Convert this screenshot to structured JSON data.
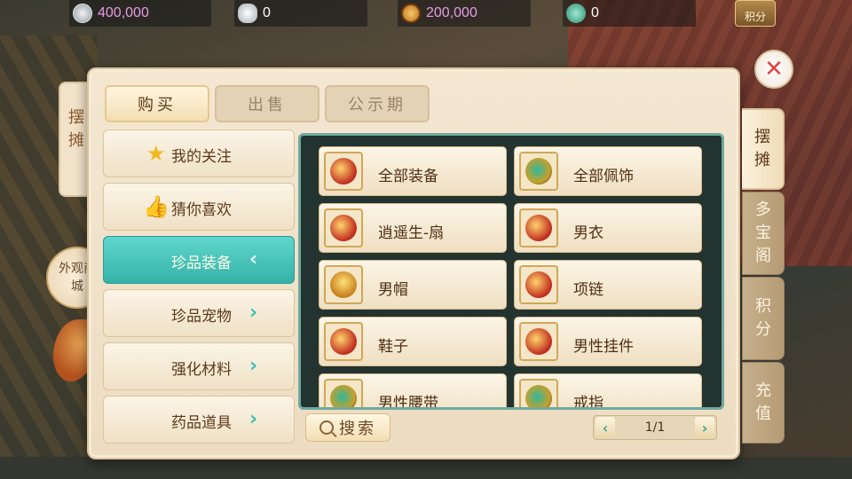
{
  "currencies": [
    {
      "icon": "silver-coin-icon",
      "value": "400,000"
    },
    {
      "icon": "silver-ingot-icon",
      "value": "0"
    },
    {
      "icon": "copper-coin-icon",
      "value": "200,000"
    },
    {
      "icon": "jade-icon",
      "value": "0"
    }
  ],
  "score_button": {
    "label": "积分"
  },
  "left_strip": {
    "label": "摆摊"
  },
  "ext_shop": {
    "label": "外观商城"
  },
  "tabs": [
    {
      "label": "购买",
      "active": true
    },
    {
      "label": "出售",
      "active": false
    },
    {
      "label": "公示期",
      "active": false
    }
  ],
  "categories": [
    {
      "label": "我的关注",
      "icon": "star-icon"
    },
    {
      "label": "猜你喜欢",
      "icon": "thumbs-up-icon"
    },
    {
      "label": "珍品装备",
      "arrow": "‹",
      "active": true
    },
    {
      "label": "珍品宠物",
      "arrow": "›"
    },
    {
      "label": "强化材料",
      "arrow": "›"
    },
    {
      "label": "药品道具",
      "arrow": "›"
    }
  ],
  "items": [
    {
      "label": "全部装备",
      "icon": "equipment-icon"
    },
    {
      "label": "全部佩饰",
      "icon": "jade-ring-icon"
    },
    {
      "label": "逍遥生-扇",
      "icon": "fan-icon"
    },
    {
      "label": "男衣",
      "icon": "armor-icon"
    },
    {
      "label": "男帽",
      "icon": "helmet-icon"
    },
    {
      "label": "项链",
      "icon": "necklace-icon"
    },
    {
      "label": "鞋子",
      "icon": "shoes-icon"
    },
    {
      "label": "男性挂件",
      "icon": "pendant-icon"
    },
    {
      "label": "男性腰带",
      "icon": "belt-icon"
    },
    {
      "label": "戒指",
      "icon": "ring-icon"
    }
  ],
  "search_button": {
    "label": "搜索"
  },
  "pager": {
    "page": "1/1",
    "prev": "‹",
    "next": "›"
  },
  "right_tabs": [
    {
      "label": "摆摊",
      "active": true
    },
    {
      "label": "多宝阁",
      "active": false
    },
    {
      "label": "积分",
      "active": false
    },
    {
      "label": "充值",
      "active": false
    }
  ],
  "close_button": {
    "glyph": "✕"
  }
}
